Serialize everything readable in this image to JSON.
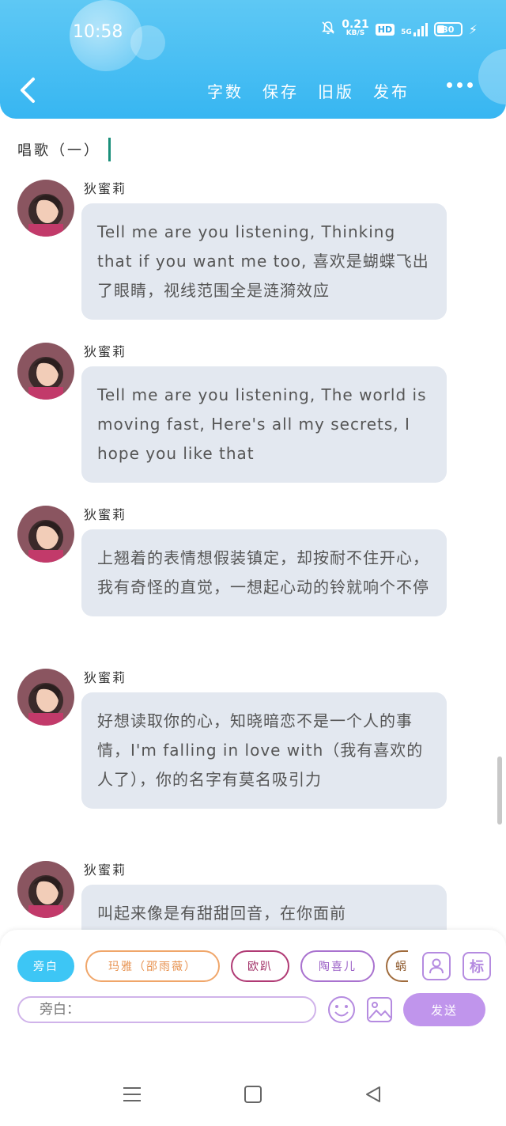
{
  "status": {
    "time": "10:58",
    "net_speed_value": "0.21",
    "net_speed_unit": "KB/S",
    "hd": "HD",
    "network": "5G",
    "battery": "30"
  },
  "header": {
    "actions": [
      "字数",
      "保存",
      "旧版",
      "发布"
    ],
    "colors": {
      "gradient_top": "#5ec8f4",
      "gradient_bottom": "#37b6f2"
    }
  },
  "title": "唱歌（一）",
  "messages": [
    {
      "name": "狄蜜莉",
      "text": "Tell me are you listening, Thinking that if you want me too, 喜欢是蝴蝶飞出了眼睛，视线范围全是涟漪效应"
    },
    {
      "name": "狄蜜莉",
      "text": "Tell me are you listening, The world is moving fast, Here's all my secrets, I hope you like that"
    },
    {
      "name": "狄蜜莉",
      "text": "上翘着的表情想假装镇定，却按耐不住开心，我有奇怪的直觉，一想起心动的铃就响个不停"
    },
    {
      "name": "狄蜜莉",
      "text": "好想读取你的心，知晓暗恋不是一个人的事情，I'm falling in love with（我有喜欢的人了），你的名字有莫名吸引力"
    },
    {
      "name": "狄蜜莉",
      "text": "叫起来像是有甜甜回音，在你面前"
    }
  ],
  "roles": [
    "旁白",
    "玛雅（邵雨薇）",
    "欧趴",
    "陶喜儿",
    "蜗"
  ],
  "input": {
    "placeholder": "旁白："
  },
  "tag_button": "标",
  "send_label": "发送"
}
